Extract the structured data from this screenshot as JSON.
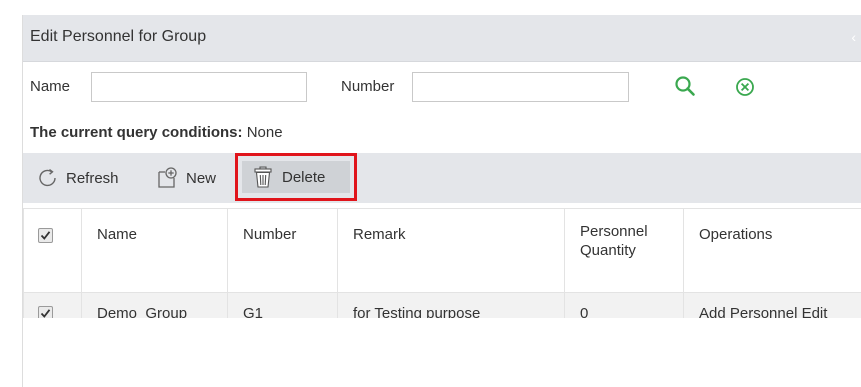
{
  "panel": {
    "title": "Edit Personnel for Group",
    "collapse_icon": "chevron-left-icon"
  },
  "search": {
    "name_label": "Name",
    "name_value": "",
    "number_label": "Number",
    "number_value": "",
    "search_icon": "search-icon",
    "clear_icon": "clear-circle-icon"
  },
  "query": {
    "label": "The current query conditions:",
    "value": "None"
  },
  "toolbar": {
    "refresh_label": "Refresh",
    "new_label": "New",
    "delete_label": "Delete",
    "refresh_icon": "refresh-icon",
    "new_icon": "new-icon",
    "delete_icon": "trash-icon",
    "highlight_color": "#e0141b"
  },
  "table": {
    "headers": {
      "select_all_checked": true,
      "name": "Name",
      "number": "Number",
      "remark": "Remark",
      "personnel_quantity_line1": "Personnel",
      "personnel_quantity_line2": "Quantity",
      "operations": "Operations"
    },
    "rows": [
      {
        "checked": true,
        "name": "Demo_Group",
        "number": "G1",
        "remark": "for Testing purpose",
        "personnel_quantity": "0",
        "op_add": "Add Personnel",
        "op_edit": "Edit"
      }
    ]
  },
  "colors": {
    "accent_green": "#3aa84f",
    "header_bg": "#e4e6ea"
  }
}
